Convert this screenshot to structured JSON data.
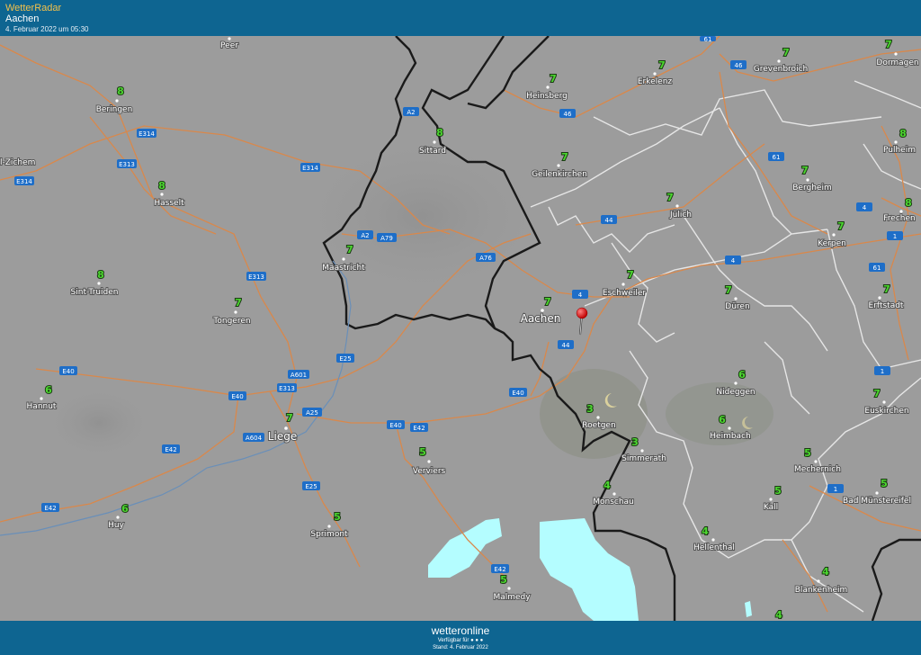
{
  "header": {
    "app_name": "WetterRadar",
    "location": "Aachen",
    "datetime": "4. Februar 2022 um 05:30"
  },
  "footer": {
    "brand": "wetteronline",
    "availability": "Verfügbar für",
    "stand": "Stand: 4. Februar 2022"
  },
  "cities": [
    {
      "name": "Peer"
    },
    {
      "name": "Beringen",
      "temp": "8"
    },
    {
      "name": "l-Zichem"
    },
    {
      "name": "Hasselt",
      "temp": "8"
    },
    {
      "name": "Sint-Truiden",
      "temp": "8"
    },
    {
      "name": "Tongeren",
      "temp": "7"
    },
    {
      "name": "Hannut",
      "temp": "6"
    },
    {
      "name": "Huy",
      "temp": "6"
    },
    {
      "name": "Liege",
      "temp": "7"
    },
    {
      "name": "Sprimont",
      "temp": "5"
    },
    {
      "name": "Verviers",
      "temp": "5"
    },
    {
      "name": "Malmedy",
      "temp": "5"
    },
    {
      "name": "Maastricht",
      "temp": "7"
    },
    {
      "name": "Sittard",
      "temp": "8"
    },
    {
      "name": "Heinsberg",
      "temp": "7"
    },
    {
      "name": "Erkelenz",
      "temp": "7"
    },
    {
      "name": "Grevenbroich",
      "temp": "7"
    },
    {
      "name": "Dormagen",
      "temp": "7"
    },
    {
      "name": "Geilenkirchen",
      "temp": "7"
    },
    {
      "name": "Pulheim",
      "temp": "8"
    },
    {
      "name": "Bergheim",
      "temp": "7"
    },
    {
      "name": "Jülich",
      "temp": "7"
    },
    {
      "name": "Frechen",
      "temp": "8"
    },
    {
      "name": "Kerpen",
      "temp": "7"
    },
    {
      "name": "Eschweiler",
      "temp": "7"
    },
    {
      "name": "Aachen",
      "temp": "7"
    },
    {
      "name": "Düren",
      "temp": "7"
    },
    {
      "name": "Erftstadt",
      "temp": "7"
    },
    {
      "name": "Nideggen",
      "temp": "6"
    },
    {
      "name": "Euskirchen",
      "temp": "7"
    },
    {
      "name": "Roetgen",
      "temp": "3"
    },
    {
      "name": "Heimbach",
      "temp": "6"
    },
    {
      "name": "Simmerath",
      "temp": "3"
    },
    {
      "name": "Mechernich",
      "temp": "5"
    },
    {
      "name": "Monschau",
      "temp": "4"
    },
    {
      "name": "Kall",
      "temp": "5"
    },
    {
      "name": "Bad Münstereifel",
      "temp": "5"
    },
    {
      "name": "Hellenthal",
      "temp": "4"
    },
    {
      "name": "Blankenheim",
      "temp": "4"
    }
  ],
  "extra_temps": [
    "4"
  ],
  "roads": [
    "E314",
    "E313",
    "E314",
    "E314",
    "A2",
    "46",
    "61",
    "46",
    "61",
    "61",
    "4",
    "44",
    "4",
    "1",
    "A2",
    "A79",
    "A76",
    "4",
    "1",
    "E313",
    "44",
    "E25",
    "A601",
    "E40",
    "E40",
    "E313",
    "A25",
    "E40",
    "E42",
    "E40",
    "A604",
    "E42",
    "E42",
    "E25",
    "E42",
    "1",
    "1"
  ],
  "colors": {
    "header_bg": "#0e6591",
    "map_bg": "#9a9a9a",
    "road": "#d9884b",
    "border_country": "#1a1a1a",
    "border_region": "#e6e6e6",
    "temp_text": "#4cd630",
    "snow": "#b4fdff",
    "road_shield": "#1e6ec8"
  },
  "icons": [
    "location-pin-icon",
    "moon-icon"
  ]
}
